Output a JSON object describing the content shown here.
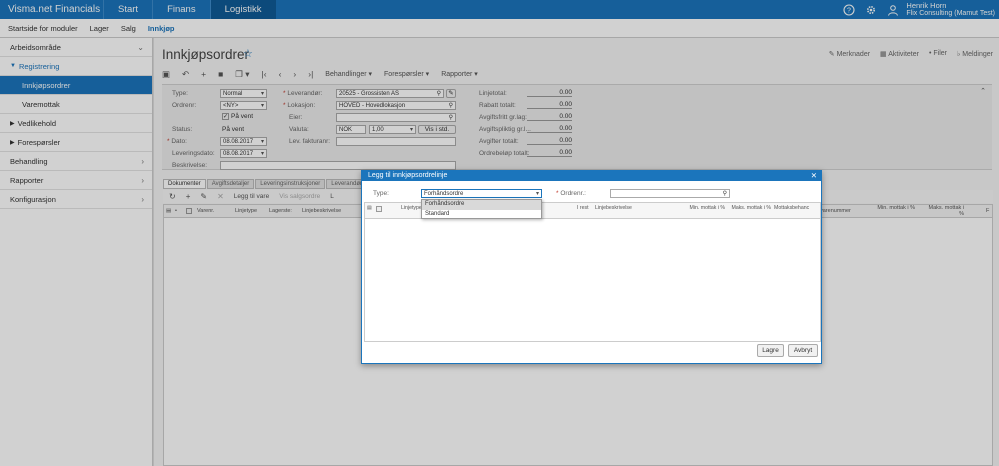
{
  "app": {
    "title": "Visma.net Financials"
  },
  "topnav": [
    "Start",
    "Finans",
    "Logistikk"
  ],
  "user": {
    "name": "Henrik Horn",
    "company": "Flix Consulting (Mamut Test)"
  },
  "subnav": [
    "Startside for moduler",
    "Lager",
    "Salg",
    "Innkjøp"
  ],
  "sidebar": {
    "section": "Arbeidsområde",
    "registrering": "Registrering",
    "innkjopsordrer": "Innkjøpsordrer",
    "varemottak": "Varemottak",
    "vedlikehold": "Vedlikehold",
    "foresporsler": "Forespørsler",
    "behandling": "Behandling",
    "rapporter": "Rapporter",
    "konfigurasjon": "Konfigurasjon"
  },
  "page": {
    "title": "Innkjøpsordrer",
    "actions": [
      "Merknader",
      "Aktiviteter",
      "Filer",
      "Meldinger"
    ]
  },
  "toolbar": {
    "behandlinger": "Behandlinger",
    "foresporsler": "Forespørsler",
    "rapporter": "Rapporter"
  },
  "form": {
    "type_label": "Type:",
    "type_value": "Normal",
    "ordrenr_label": "Ordrenr:",
    "ordrenr_value": "<NY>",
    "pa_vent_cb": "På vent",
    "status_label": "Status:",
    "status_value": "På vent",
    "dato_label": "Dato:",
    "dato_value": "08.08.2017",
    "leveringsdato_label": "Leveringsdato:",
    "leveringsdato_value": "08.08.2017",
    "beskrivelse_label": "Beskrivelse:",
    "leverandor_label": "Leverandør:",
    "leverandor_value": "20525 - Grossisten AS",
    "lokasjon_label": "Lokasjon:",
    "lokasjon_value": "HOVED - Hovedlokasjon",
    "eier_label": "Eier:",
    "valuta_label": "Valuta:",
    "valuta_value": "NOK",
    "kurs_value": "1,00",
    "vis_i_std": "Vis i std.",
    "lev_faktura_label": "Lev. fakturanr:",
    "totals": [
      {
        "label": "Linjetotal:",
        "value": "0.00"
      },
      {
        "label": "Rabatt totalt:",
        "value": "0.00"
      },
      {
        "label": "Avgiftsfritt gr.lag:",
        "value": "0.00"
      },
      {
        "label": "Avgiftspliktig gr.l...",
        "value": "0.00"
      },
      {
        "label": "Avgifter totalt:",
        "value": "0.00"
      },
      {
        "label": "Ordrebeløp totalt:",
        "value": "0.00"
      }
    ]
  },
  "tabs": [
    "Dokumenter",
    "Avgiftsdetaljer",
    "Leveringsinstruksjoner",
    "Leverandørinfo"
  ],
  "grid_toolbar": {
    "legg_til_vare": "Legg til vare",
    "vis_salgsordre": "Vis salgsordre",
    "l": "L"
  },
  "grid_headers": [
    "Varenr.",
    "Linjetype",
    "Lagerste:",
    "Linjebeskrivelse"
  ],
  "bg_right_headers": [
    "varenummer",
    "Min. mottak i %",
    "Maks. mottak i %",
    "F"
  ],
  "dialog": {
    "title": "Legg til innkjøpsordrelinje",
    "type_label": "Type:",
    "type_value": "Forhåndsordre",
    "ordrenr_label": "Ordrenr.:",
    "options": [
      "Forhåndsordre",
      "Standard"
    ],
    "headers": [
      "Linjetype",
      "I rest",
      "Linjebeskrivelse",
      "Min. mottak i %",
      "Maks. mottak i %",
      "Mottaksbehanc"
    ],
    "lagre": "Lagre",
    "avbryt": "Avbryt"
  }
}
